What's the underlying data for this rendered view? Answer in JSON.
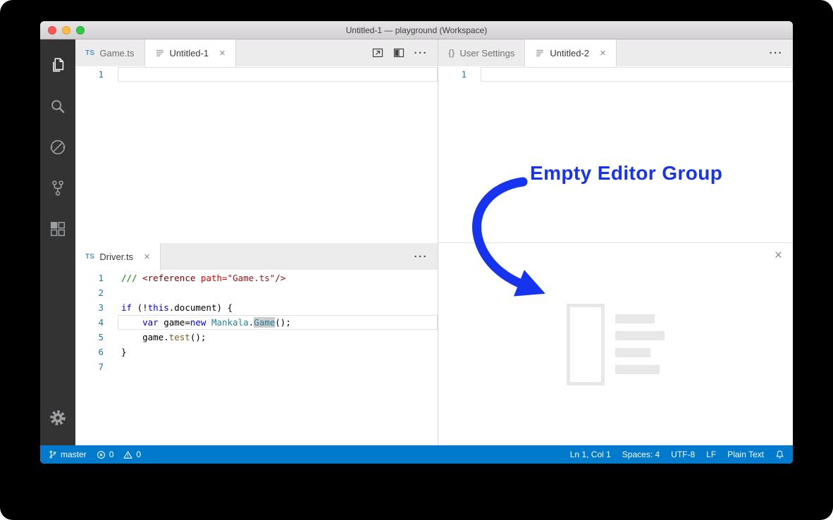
{
  "window": {
    "title": "Untitled-1 — playground (Workspace)"
  },
  "activity_bar": {
    "items": [
      {
        "icon": "files",
        "name": "explorer-icon",
        "active": true
      },
      {
        "icon": "search",
        "name": "search-icon",
        "active": false
      },
      {
        "icon": "debug",
        "name": "debug-icon",
        "active": false
      },
      {
        "icon": "git",
        "name": "source-control-icon",
        "active": false
      },
      {
        "icon": "extensions",
        "name": "extensions-icon",
        "active": false
      }
    ],
    "bottom_items": [
      {
        "icon": "gear",
        "name": "settings-gear-icon",
        "active": false
      }
    ]
  },
  "editor_groups": {
    "top_left": {
      "tabs": [
        {
          "label": "Game.ts",
          "icon": "ts",
          "active": false,
          "closable": false
        },
        {
          "label": "Untitled-1",
          "icon": "file",
          "active": true,
          "closable": true
        }
      ],
      "actions": [
        {
          "icon": "split-editor",
          "name": "split-editor-button"
        },
        {
          "icon": "toggle-layout",
          "name": "toggle-layout-button"
        },
        {
          "icon": "more",
          "name": "more-actions-button"
        }
      ],
      "lines": [
        {
          "num": "1",
          "current": true,
          "tokens": []
        }
      ]
    },
    "bottom_left": {
      "tabs": [
        {
          "label": "Driver.ts",
          "icon": "ts",
          "active": true,
          "closable": true
        }
      ],
      "actions": [
        {
          "icon": "more",
          "name": "more-actions-button"
        }
      ],
      "lines": [
        {
          "num": "1",
          "tokens": [
            {
              "t": "/// ",
              "c": "comment"
            },
            {
              "t": "<reference ",
              "c": "tag"
            },
            {
              "t": "path=",
              "c": "attr"
            },
            {
              "t": "\"Game.ts\"",
              "c": "str"
            },
            {
              "t": "/>",
              "c": "tag"
            }
          ]
        },
        {
          "num": "2",
          "tokens": []
        },
        {
          "num": "3",
          "tokens": [
            {
              "t": "if",
              "c": "kw"
            },
            {
              "t": " (!",
              "c": "plain"
            },
            {
              "t": "this",
              "c": "kw"
            },
            {
              "t": ".document) {",
              "c": "plain"
            }
          ]
        },
        {
          "num": "4",
          "current": true,
          "tokens": [
            {
              "t": "    ",
              "c": "plain"
            },
            {
              "t": "var",
              "c": "kw"
            },
            {
              "t": " game=",
              "c": "plain"
            },
            {
              "t": "new",
              "c": "kw"
            },
            {
              "t": " ",
              "c": "plain"
            },
            {
              "t": "Mankala",
              "c": "type"
            },
            {
              "t": ".",
              "c": "plain"
            },
            {
              "t": "Game",
              "c": "type hl"
            },
            {
              "t": "();",
              "c": "plain"
            }
          ]
        },
        {
          "num": "5",
          "tokens": [
            {
              "t": "    game.",
              "c": "plain"
            },
            {
              "t": "test",
              "c": "fn"
            },
            {
              "t": "();",
              "c": "plain"
            }
          ]
        },
        {
          "num": "6",
          "tokens": [
            {
              "t": "}",
              "c": "plain"
            }
          ]
        },
        {
          "num": "7",
          "tokens": []
        }
      ]
    },
    "top_right": {
      "tabs": [
        {
          "label": "User Settings",
          "icon": "braces",
          "active": false,
          "closable": false
        },
        {
          "label": "Untitled-2",
          "icon": "file",
          "active": true,
          "closable": true
        }
      ],
      "actions": [
        {
          "icon": "more",
          "name": "more-actions-button"
        }
      ],
      "lines": [
        {
          "num": "1",
          "current": true,
          "tokens": []
        }
      ]
    },
    "bottom_right": {
      "close_label": "×"
    }
  },
  "annotation": {
    "text": "Empty Editor Group"
  },
  "status_bar": {
    "left": [
      {
        "icon": "branch",
        "label": "master",
        "name": "git-branch"
      },
      {
        "icon": "error",
        "label": "0",
        "name": "error-count"
      },
      {
        "icon": "warning",
        "label": "0",
        "name": "warning-count"
      }
    ],
    "right": [
      {
        "label": "Ln 1, Col 1",
        "name": "cursor-position"
      },
      {
        "label": "Spaces: 4",
        "name": "indentation"
      },
      {
        "label": "UTF-8",
        "name": "encoding"
      },
      {
        "label": "LF",
        "name": "eol"
      },
      {
        "label": "Plain Text",
        "name": "language-mode"
      },
      {
        "icon": "bell",
        "name": "notifications-bell-icon"
      }
    ]
  },
  "colors": {
    "accent": "#007acc",
    "annotation": "#1634f0",
    "ts_icon": "#519aba"
  }
}
